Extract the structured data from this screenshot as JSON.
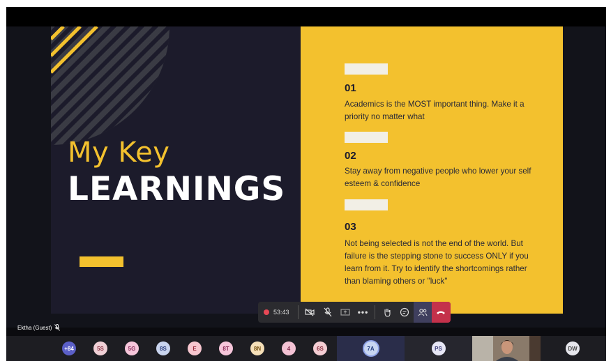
{
  "slide": {
    "title_line1": "My Key",
    "title_line2": "LEARNINGS",
    "items": [
      {
        "number": "01",
        "text": "Academics is the MOST important thing. Make it a priority no matter what"
      },
      {
        "number": "02",
        "text": "Stay away from negative people who lower your self esteem & confidence"
      },
      {
        "number": "03",
        "text": "Not being selected is not the end of the world. But failure is the stepping stone to success ONLY if you learn from it. Try to identify the shortcomings rather than blaming others or \"luck\""
      }
    ],
    "colors": {
      "accent": "#f3c12e",
      "dark": "#1c1b2b"
    }
  },
  "presenter": {
    "name": "Ektha (Guest)",
    "icon": "mic-off-icon"
  },
  "toolbar": {
    "timer": "53:43",
    "buttons": [
      "camera-off-icon",
      "mic-off-icon",
      "share-icon",
      "more-icon",
      "raise-hand-icon",
      "chat-icon",
      "people-icon",
      "hang-up-icon"
    ]
  },
  "participants": [
    {
      "initials": "+84",
      "color": "#5b5fc7",
      "text_color": "#ffffff"
    },
    {
      "initials": "5S",
      "color": "#f0d0d6",
      "text_color": "#8a3344"
    },
    {
      "initials": "5G",
      "color": "#f6c6db",
      "text_color": "#8a2d5b"
    },
    {
      "initials": "8S",
      "color": "#c9d4ee",
      "text_color": "#2a3c7a"
    },
    {
      "initials": "E",
      "color": "#f7c6cf",
      "text_color": "#9b2c3e"
    },
    {
      "initials": "8T",
      "color": "#f6c6da",
      "text_color": "#8b2c58"
    },
    {
      "initials": "8N",
      "color": "#f5dfb8",
      "text_color": "#7a5516"
    },
    {
      "initials": "4",
      "color": "#f3c2d4",
      "text_color": "#852e4f"
    },
    {
      "initials": "6S",
      "color": "#f4cdd3",
      "text_color": "#8a2f3f"
    },
    {
      "initials": "7A",
      "color": "#c8d6f2",
      "text_color": "#263f80"
    },
    {
      "initials": "PS",
      "color": "#e6e6f5",
      "text_color": "#3b3b78"
    },
    {
      "initials": "DW",
      "color": "#e6e6ec",
      "text_color": "#444"
    }
  ]
}
